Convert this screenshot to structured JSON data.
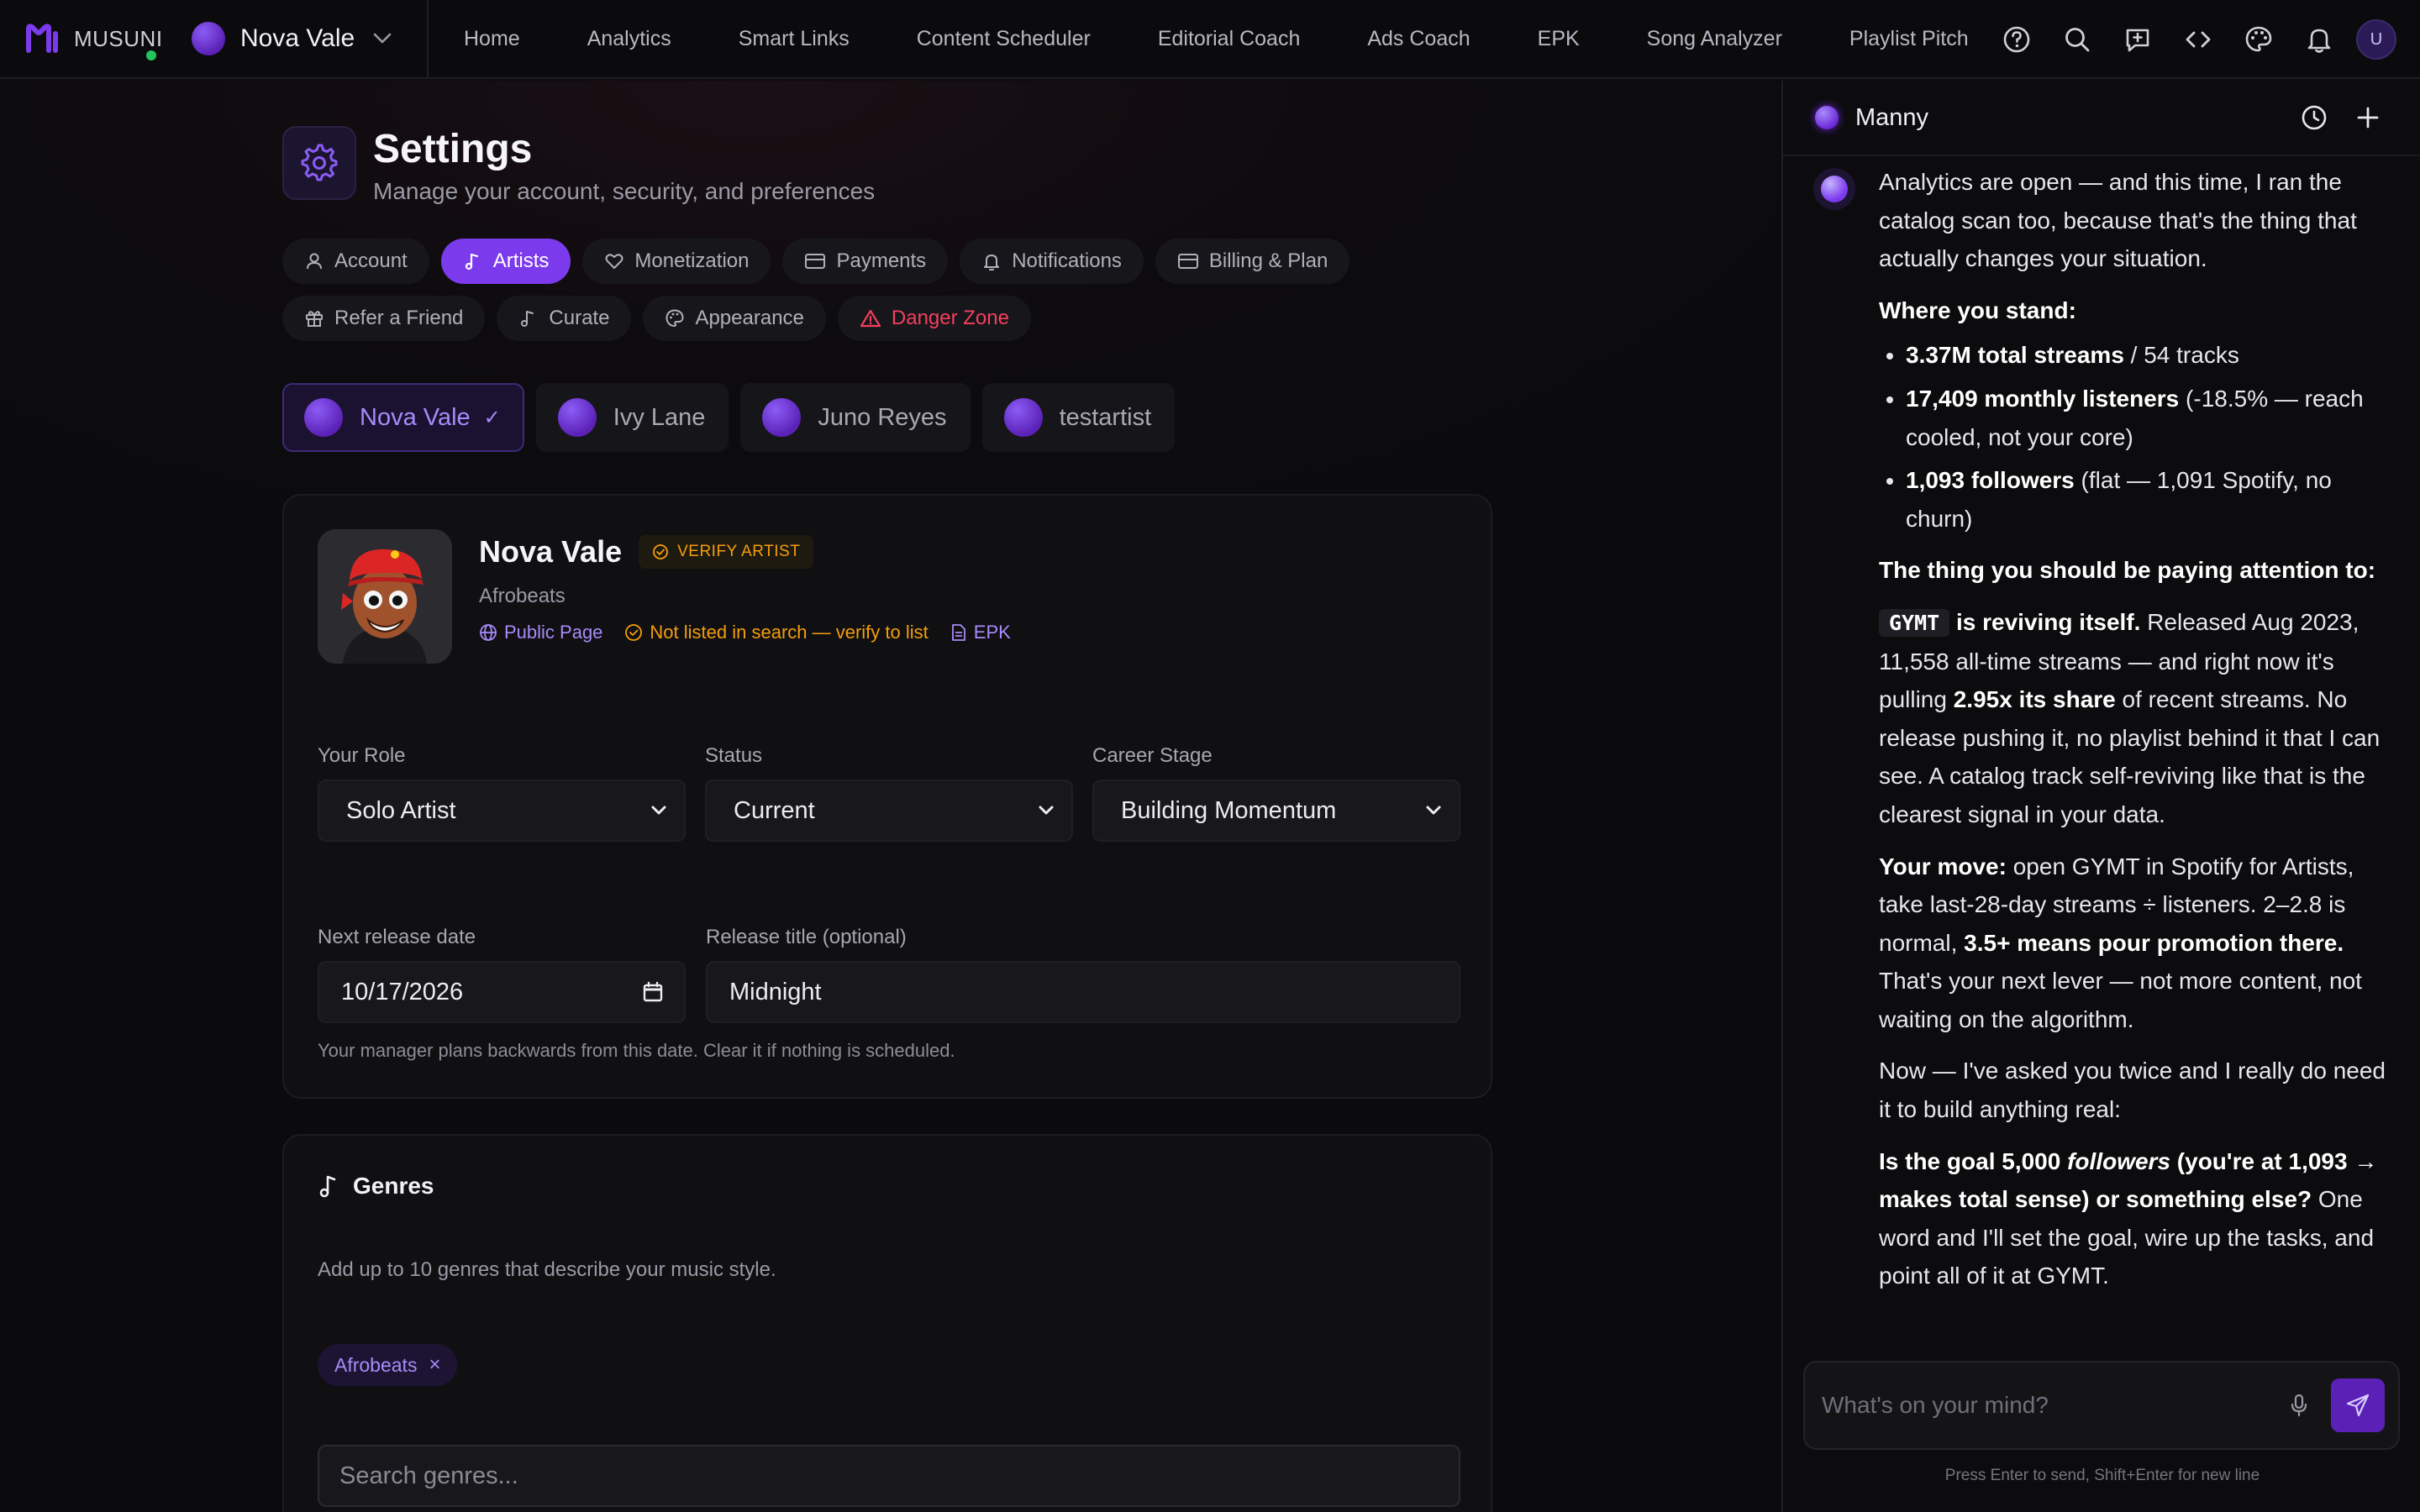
{
  "brand": {
    "name": "MUSUNI"
  },
  "artist_switcher": {
    "name": "Nova Vale"
  },
  "nav": {
    "links": [
      "Home",
      "Analytics",
      "Smart Links",
      "Content Scheduler",
      "Editorial Coach",
      "Ads Coach",
      "EPK",
      "Song Analyzer",
      "Playlist Pitch"
    ],
    "icons": [
      "help-icon",
      "search-icon",
      "feedback-icon",
      "code-icon",
      "palette-icon",
      "bell-icon"
    ],
    "user_initial": "U"
  },
  "page": {
    "title": "Settings",
    "subtitle": "Manage your account, security, and preferences"
  },
  "tabs": {
    "account": "Account",
    "artists": "Artists",
    "monetization": "Monetization",
    "payments": "Payments",
    "notifications": "Notifications",
    "billing": "Billing & Plan",
    "refer": "Refer a Friend",
    "curate": "Curate",
    "appearance": "Appearance",
    "danger": "Danger Zone"
  },
  "artists": [
    {
      "name": "Nova Vale",
      "active": true
    },
    {
      "name": "Ivy Lane",
      "active": false
    },
    {
      "name": "Juno Reyes",
      "active": false
    },
    {
      "name": "testartist",
      "active": false
    }
  ],
  "profile": {
    "name": "Nova Vale",
    "verify_label": "VERIFY ARTIST",
    "genre": "Afrobeats",
    "public_page": "Public Page",
    "search_notice": "Not listed in search — verify to list",
    "epk": "EPK",
    "role": {
      "label": "Your Role",
      "value": "Solo Artist"
    },
    "status": {
      "label": "Status",
      "value": "Current"
    },
    "career": {
      "label": "Career Stage",
      "value": "Building Momentum"
    },
    "release_date": {
      "label": "Next release date",
      "value": "10/17/2026"
    },
    "release_title": {
      "label": "Release title (optional)",
      "value": "Midnight"
    },
    "helper": "Your manager plans backwards from this date. Clear it if nothing is scheduled."
  },
  "genres": {
    "title": "Genres",
    "description": "Add up to 10 genres that describe your music style.",
    "selected": [
      "Afrobeats"
    ],
    "search_placeholder": "Search genres..."
  },
  "chat": {
    "assistant_name": "Manny",
    "intro": "Analytics are open — and this time, I ran the catalog scan too, because that's the thing that actually changes your situation.",
    "where_heading": "Where you stand:",
    "stats": [
      {
        "bold": "3.37M total streams",
        "rest": " / 54 tracks"
      },
      {
        "bold": "17,409 monthly listeners",
        "rest": " (-18.5% — reach cooled, not your core)"
      },
      {
        "bold": "1,093 followers",
        "rest": " (flat — 1,091 Spotify, no churn)"
      }
    ],
    "attention_heading": "The thing you should be paying attention to:",
    "track_code": "GYMT",
    "track_bold": " is reviving itself.",
    "track_text1": " Released Aug 2023, 11,558 all-time streams — and right now it's pulling ",
    "track_bold2": "2.95x its share",
    "track_text2": " of recent streams. No release pushing it, no playlist behind it that I can see. A catalog track self-reviving like that is the clearest signal in your data.",
    "move_bold": "Your move:",
    "move_text1": " open GYMT in Spotify for Artists, take last-28-day streams ÷ listeners. 2–2.8 is normal, ",
    "move_bold2": "3.5+ means pour promotion there.",
    "move_text2": " That's your next lever — not more content, not waiting on the algorithm.",
    "ask_text": "Now — I've asked you twice and I really do need it to build anything real:",
    "goal_bold1": "Is the goal 5,000 ",
    "goal_italic": "followers",
    "goal_bold2": " (you're at 1,093 → makes total sense) or something else?",
    "goal_text": " One word and I'll set the goal, wire up the tasks, and point all of it at GYMT.",
    "input_placeholder": "What's on your mind?",
    "hint": "Press Enter to send, Shift+Enter for new line"
  },
  "colors": {
    "accent": "#7c3aed",
    "accent_text": "#a78bfa",
    "warning": "#f59e0b",
    "danger": "#f43f5e",
    "online": "#22c55e"
  }
}
